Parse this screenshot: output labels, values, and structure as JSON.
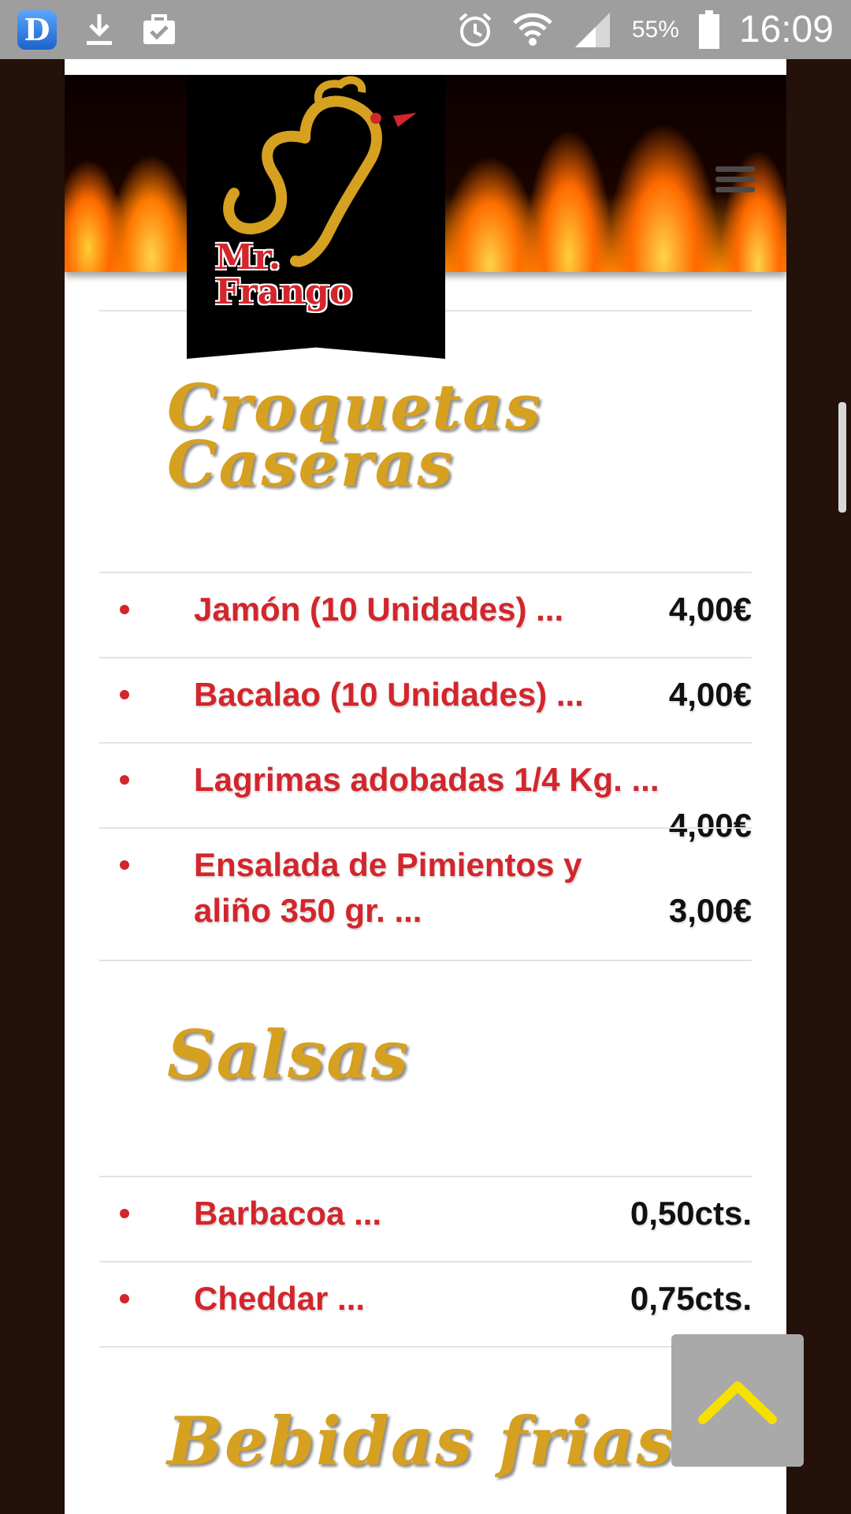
{
  "status_bar": {
    "battery": "55%",
    "time": "16:09",
    "app_badge": "D"
  },
  "logo": {
    "line1": "Mr.",
    "line2": "Frango"
  },
  "sections": {
    "croquetas": {
      "title_line1": "Croquetas",
      "title_line2": "Caseras",
      "items": [
        {
          "name": "Jamón (10 Unidades) ...",
          "price": "4,00€"
        },
        {
          "name": "Bacalao (10 Unidades) ...",
          "price": "4,00€"
        },
        {
          "name": "Lagrimas adobadas 1/4 Kg. ...",
          "price": "4,00€"
        },
        {
          "name_line1": "Ensalada de Pimientos y",
          "name_line2": "aliño 350 gr. ...",
          "price": "3,00€"
        }
      ]
    },
    "salsas": {
      "title": "Salsas",
      "items": [
        {
          "name": "Barbacoa ...",
          "price": "0,50cts."
        },
        {
          "name": "Cheddar ...",
          "price": "0,75cts."
        }
      ]
    },
    "bebidas": {
      "title": "Bebidas frias"
    }
  },
  "icons": {
    "menu": "hamburger-menu-icon",
    "back_to_top": "chevron-up-icon"
  },
  "colors": {
    "accent_red": "#d2262c",
    "title_gold": "#d6a020",
    "side_brown": "#24110a"
  }
}
